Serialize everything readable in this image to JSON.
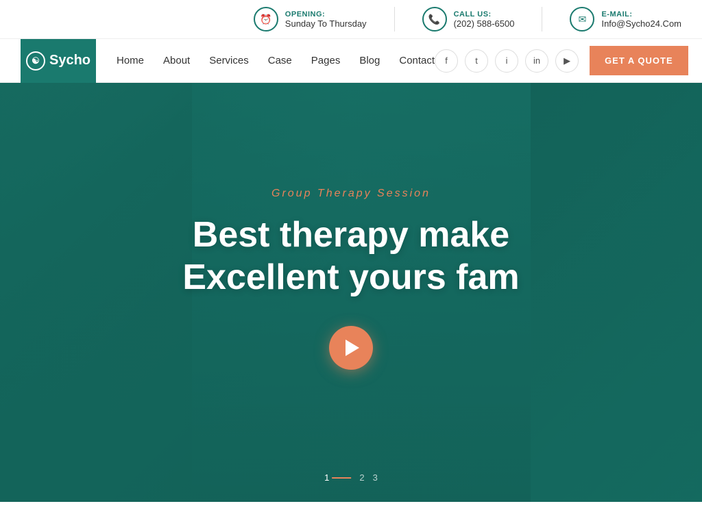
{
  "topbar": {
    "opening_label": "OPENING:",
    "opening_value": "Sunday To Thursday",
    "call_label": "CALL US:",
    "call_value": "(202) 588-6500",
    "email_label": "E-MAIL:",
    "email_value": "Info@Sycho24.Com"
  },
  "logo": {
    "text": "Sycho",
    "icon": "☯"
  },
  "nav": {
    "links": [
      {
        "label": "Home"
      },
      {
        "label": "About"
      },
      {
        "label": "Services"
      },
      {
        "label": "Case"
      },
      {
        "label": "Pages"
      },
      {
        "label": "Blog"
      },
      {
        "label": "Contact"
      }
    ]
  },
  "social": {
    "items": [
      {
        "name": "facebook",
        "icon": "f"
      },
      {
        "name": "twitter",
        "icon": "t"
      },
      {
        "name": "instagram",
        "icon": "in"
      },
      {
        "name": "linkedin",
        "icon": "li"
      },
      {
        "name": "youtube",
        "icon": "▶"
      }
    ]
  },
  "header": {
    "get_quote": "GET A QUOTE"
  },
  "hero": {
    "subtitle": "Group Therapy Session",
    "title_line1": "Best therapy make",
    "title_line2": "Excellent yours fam"
  },
  "slider": {
    "dots": [
      {
        "label": "1",
        "active": true
      },
      {
        "label": "2",
        "active": false
      },
      {
        "label": "3",
        "active": false
      }
    ]
  },
  "colors": {
    "teal": "#1a7a6e",
    "orange": "#e8835a",
    "white": "#ffffff"
  }
}
